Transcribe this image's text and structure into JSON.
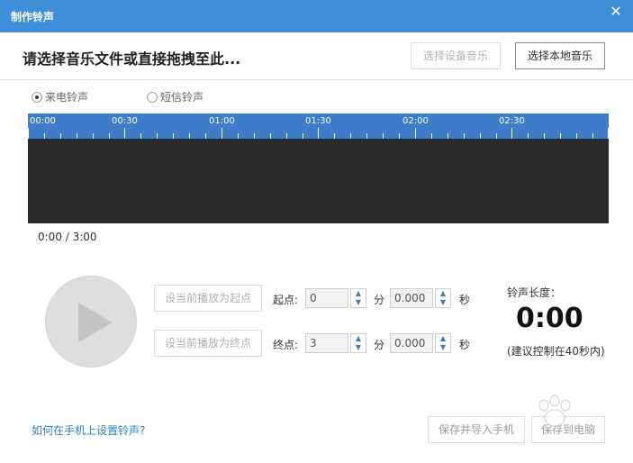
{
  "window": {
    "title": "制作铃声",
    "close_glyph": "✕"
  },
  "header": {
    "prompt": "请选择音乐文件或直接拖拽至此...",
    "device_music_label": "选择设备音乐",
    "local_music_label": "选择本地音乐"
  },
  "mode": {
    "options": [
      {
        "label": "来电铃声",
        "selected": true
      },
      {
        "label": "短信铃声",
        "selected": false
      }
    ]
  },
  "timeline": {
    "labels": [
      "00:00",
      "00:30",
      "01:00",
      "01:30",
      "02:00",
      "02:30"
    ],
    "accent": "#3d7cc9",
    "wave_bg": "#2a2b2d"
  },
  "playback": {
    "position_text": "0:00 / 3:00",
    "set_start_label": "设当前播放为起点",
    "set_end_label": "设当前播放为终点"
  },
  "start": {
    "label": "起点:",
    "minutes": "0",
    "minutes_unit": "分",
    "seconds": "0.000",
    "seconds_unit": "秒"
  },
  "end": {
    "label": "终点:",
    "minutes": "3",
    "minutes_unit": "分",
    "seconds": "0.000",
    "seconds_unit": "秒"
  },
  "ringtone": {
    "length_label": "铃声长度：",
    "length_value": "0:00",
    "hint": "(建议控制在40秒内)"
  },
  "footer": {
    "help_link": "如何在手机上设置铃声?",
    "save_import_label": "保存并导入手机",
    "save_pc_label": "保存到电脑"
  },
  "watermark": {
    "text": "Baidu经验"
  },
  "colors": {
    "titlebar": "#3e8fd8",
    "link": "#2e7fc6"
  }
}
